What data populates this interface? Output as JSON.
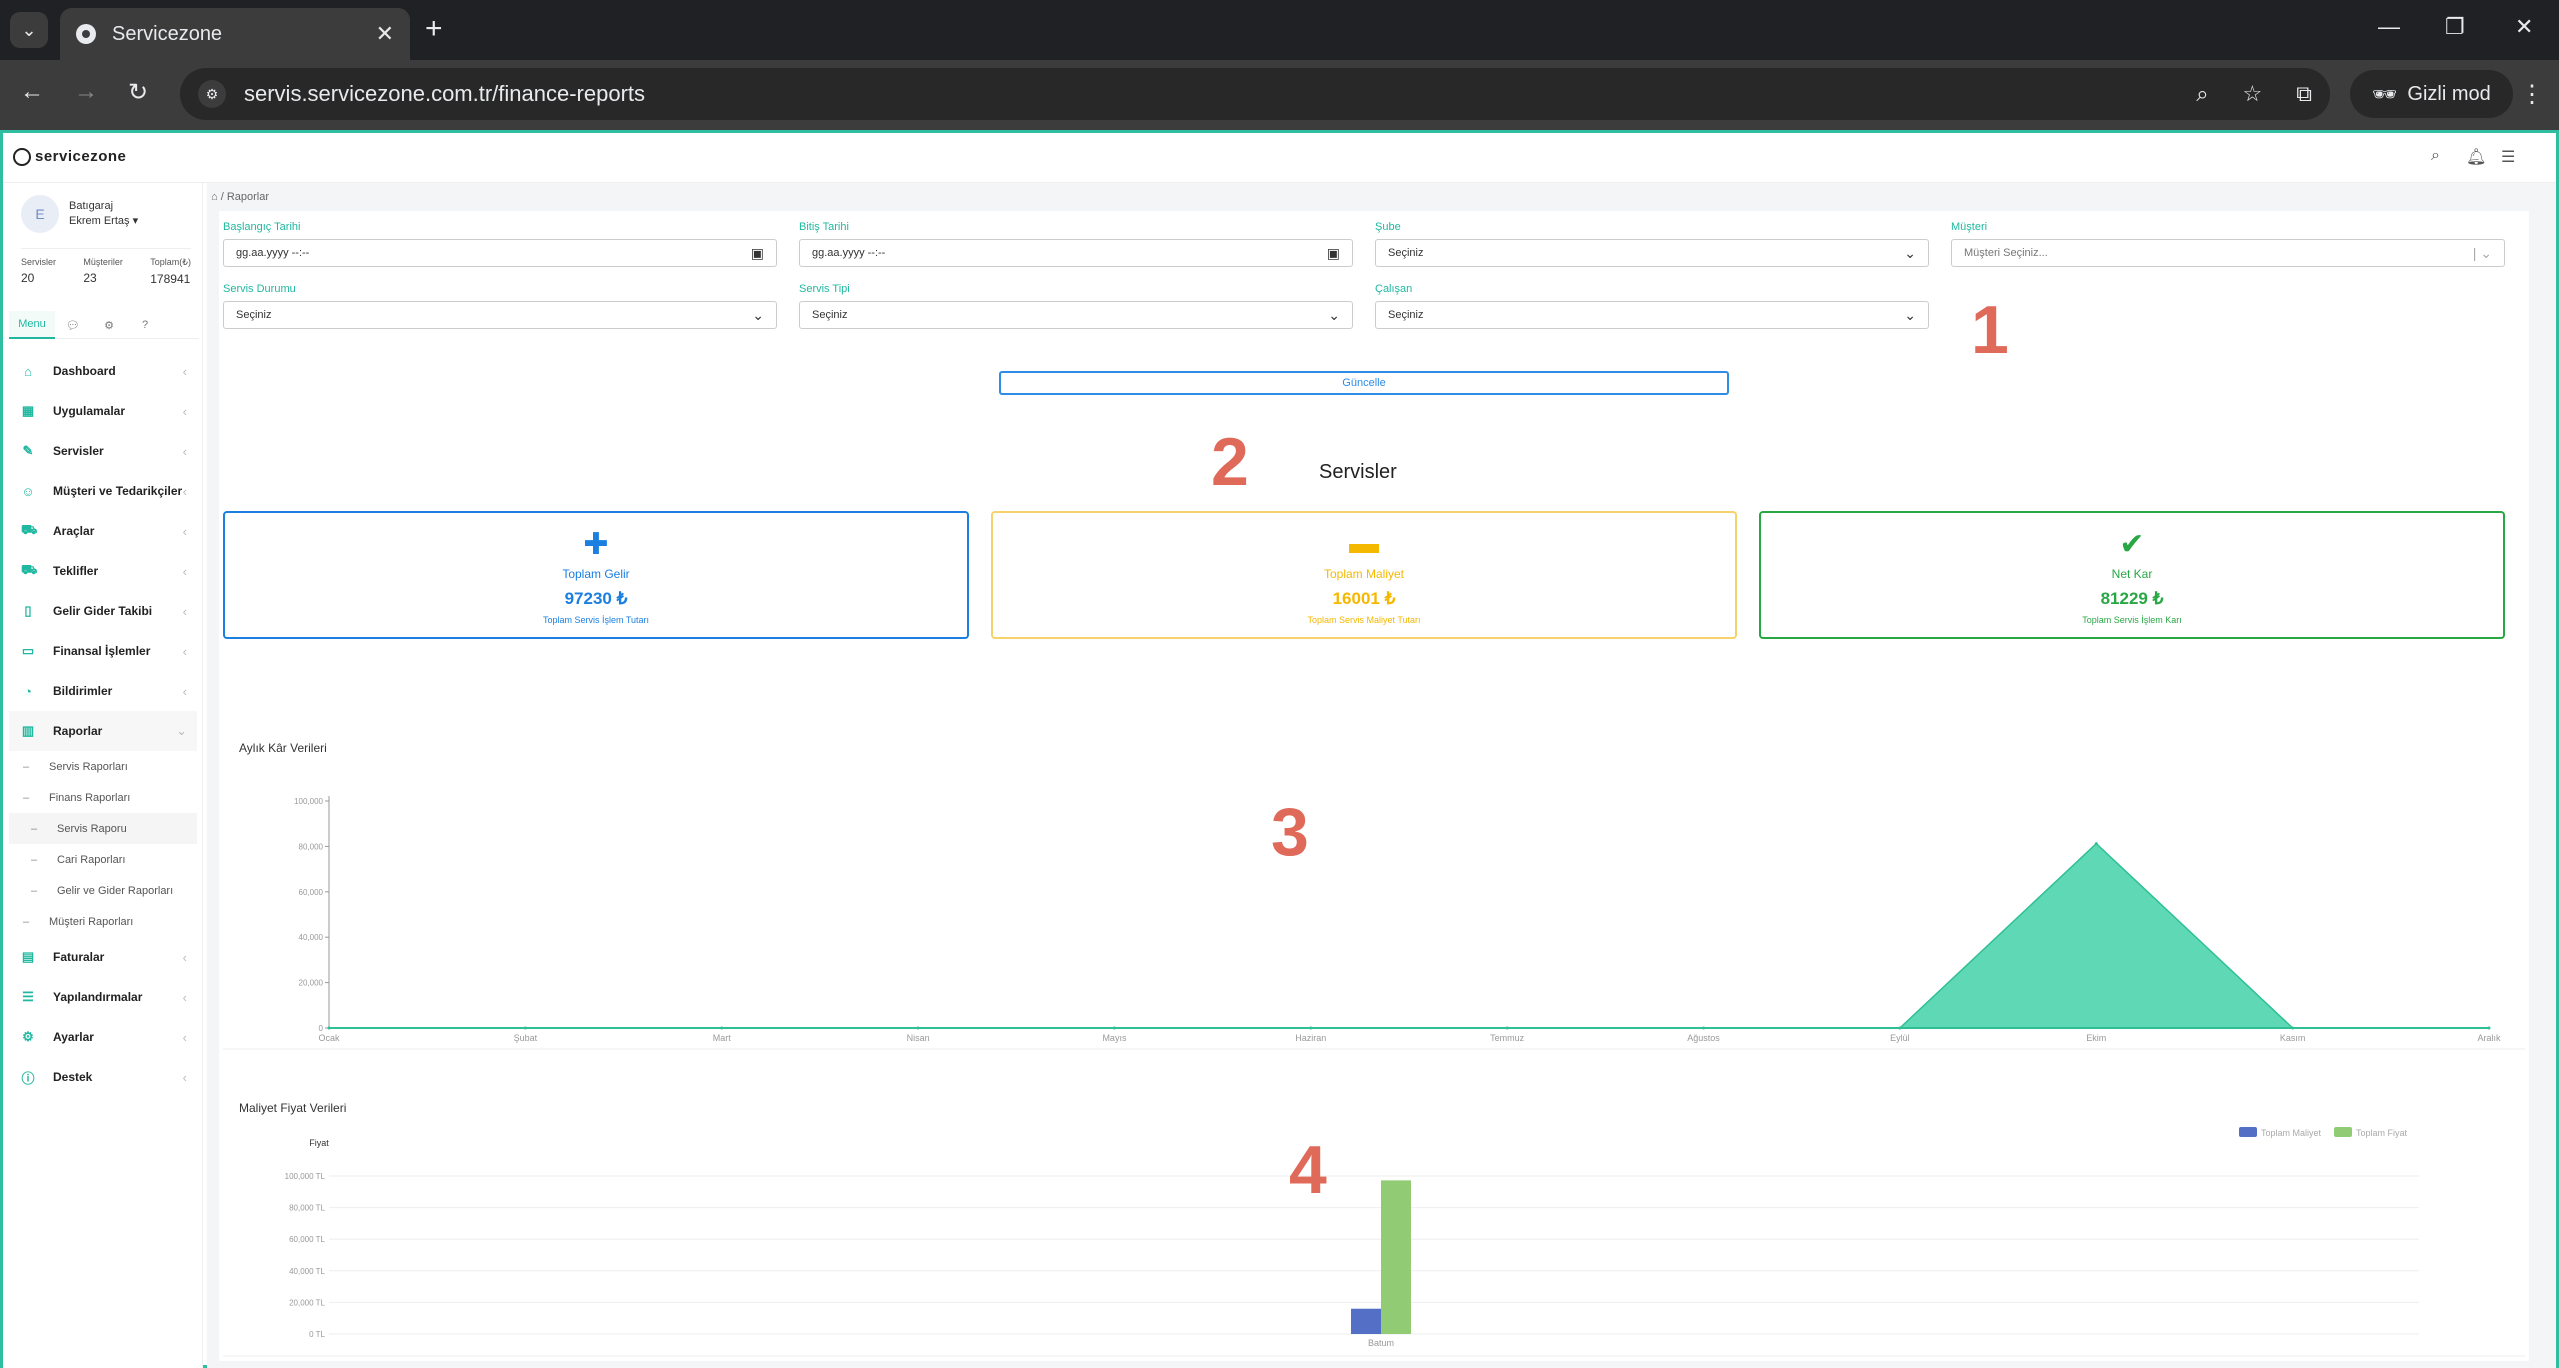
{
  "browser": {
    "tab_title": "Servicezone",
    "url": "servis.servicezone.com.tr/finance-reports",
    "incognito_label": "Gizli mod"
  },
  "app": {
    "logo_text": "servicezone"
  },
  "user": {
    "initial": "E",
    "company": "Batıgaraj",
    "name": "Ekrem Ertaş ▾"
  },
  "stats": [
    {
      "label": "Servisler",
      "value": "20"
    },
    {
      "label": "Müşteriler",
      "value": "23"
    },
    {
      "label": "Toplam(₺)",
      "value": "178941"
    }
  ],
  "sidebar_tabs": {
    "menu": "Menu"
  },
  "menu": [
    {
      "label": "Dashboard",
      "icon": "⌂"
    },
    {
      "label": "Uygulamalar",
      "icon": "▦"
    },
    {
      "label": "Servisler",
      "icon": "✎"
    },
    {
      "label": "Müşteri ve Tedarikçiler",
      "icon": "☺"
    },
    {
      "label": "Araçlar",
      "icon": "⛟"
    },
    {
      "label": "Teklifler",
      "icon": "⛟"
    },
    {
      "label": "Gelir Gider Takibi",
      "icon": "▯"
    },
    {
      "label": "Finansal İşlemler",
      "icon": "▭"
    },
    {
      "label": "Bildirimler",
      "icon": "◔"
    },
    {
      "label": "Raporlar",
      "icon": "▥"
    }
  ],
  "submenu": {
    "servis_raporlari": "Servis Raporları",
    "finans_raporlari": "Finans Raporları",
    "servis_raporu": "Servis Raporu",
    "cari_raporlari": "Cari Raporları",
    "gelir_gider_raporlari": "Gelir ve Gider Raporları",
    "musteri_raporlari": "Müşteri Raporları"
  },
  "menu_bottom": [
    {
      "label": "Faturalar",
      "icon": "▤"
    },
    {
      "label": "Yapılandırmalar",
      "icon": "☰"
    },
    {
      "label": "Ayarlar",
      "icon": "⚙"
    },
    {
      "label": "Destek",
      "icon": "ⓘ"
    }
  ],
  "breadcrumb": {
    "page": "Raporlar"
  },
  "filters": {
    "start_date": {
      "label": "Başlangıç Tarihi",
      "value": "gg.aa.yyyy --:--"
    },
    "end_date": {
      "label": "Bitiş Tarihi",
      "value": "gg.aa.yyyy --:--"
    },
    "branch": {
      "label": "Şube",
      "value": "Seçiniz"
    },
    "customer": {
      "label": "Müşteri",
      "value": "Müşteri Seçiniz..."
    },
    "status": {
      "label": "Servis Durumu",
      "value": "Seçiniz"
    },
    "type": {
      "label": "Servis Tipi",
      "value": "Seçiniz"
    },
    "employee": {
      "label": "Çalışan",
      "value": "Seçiniz"
    }
  },
  "update_button": "Güncelle",
  "annotations": [
    "1",
    "2",
    "3",
    "4"
  ],
  "section_title": "Servisler",
  "kpis": {
    "income": {
      "title": "Toplam Gelir",
      "value": "97230 ₺",
      "sub": "Toplam Servis İşlem Tutarı",
      "color": "#1a7fe0"
    },
    "cost": {
      "title": "Toplam Maliyet",
      "value": "16001 ₺",
      "sub": "Toplam Servis Maliyet Tutarı",
      "color": "#f5b800"
    },
    "profit": {
      "title": "Net Kar",
      "value": "81229 ₺",
      "sub": "Toplam Servis İşlem Karı",
      "color": "#28a745"
    }
  },
  "chart_data": [
    {
      "type": "area",
      "title": "Aylık Kâr Verileri",
      "categories": [
        "Ocak",
        "Şubat",
        "Mart",
        "Nisan",
        "Mayıs",
        "Haziran",
        "Temmuz",
        "Ağustos",
        "Eylül",
        "Ekim",
        "Kasım",
        "Aralık"
      ],
      "values": [
        0,
        0,
        0,
        0,
        0,
        0,
        0,
        0,
        0,
        81229,
        0,
        0
      ],
      "yticks": [
        "0",
        "20,000",
        "40,000",
        "60,000",
        "80,000",
        "100,000"
      ],
      "ylim": [
        0,
        100000
      ],
      "color": "#5fd8b5"
    },
    {
      "type": "bar",
      "title": "Maliyet Fiyat Verileri",
      "ylabel": "Fiyat",
      "categories": [
        "Batum"
      ],
      "series": [
        {
          "name": "Toplam Maliyet",
          "values": [
            16001
          ],
          "color": "#5470c6"
        },
        {
          "name": "Toplam Fiyat",
          "values": [
            97230
          ],
          "color": "#91cc75"
        }
      ],
      "yticks": [
        "0 TL",
        "20,000 TL",
        "40,000 TL",
        "60,000 TL",
        "80,000 TL",
        "100,000 TL"
      ],
      "ylim": [
        0,
        100000
      ],
      "legend": "top-right"
    }
  ]
}
